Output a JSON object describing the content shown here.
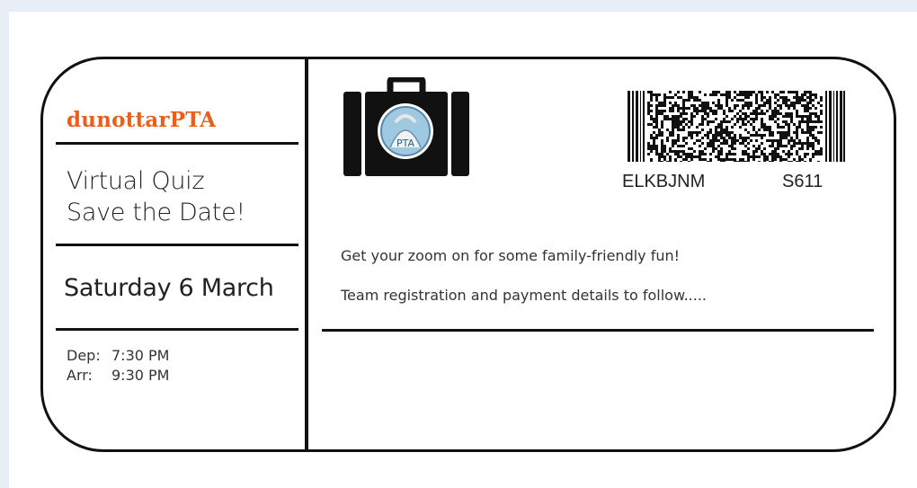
{
  "ticket": {
    "brand": "dunottarPTA",
    "event_title_line1": "Virtual Quiz",
    "event_title_line2": "Save the Date!",
    "event_date": "Saturday 6 March",
    "departure_label": "Dep:",
    "departure_time": "7:30 PM",
    "arrival_label": "Arr:",
    "arrival_time": "9:30 PM",
    "booking_code": "ELKBJNM",
    "seat_code": "S611",
    "message_line1": "Get your zoom on for some family-friendly fun!",
    "message_line2": "Team registration and payment details to follow.....",
    "logo_text": "PTA",
    "icons": [
      "suitcase-icon",
      "barcode-icon"
    ],
    "colors": {
      "brand": "#e8601c",
      "border": "#111111",
      "background": "#e8eef6"
    }
  }
}
